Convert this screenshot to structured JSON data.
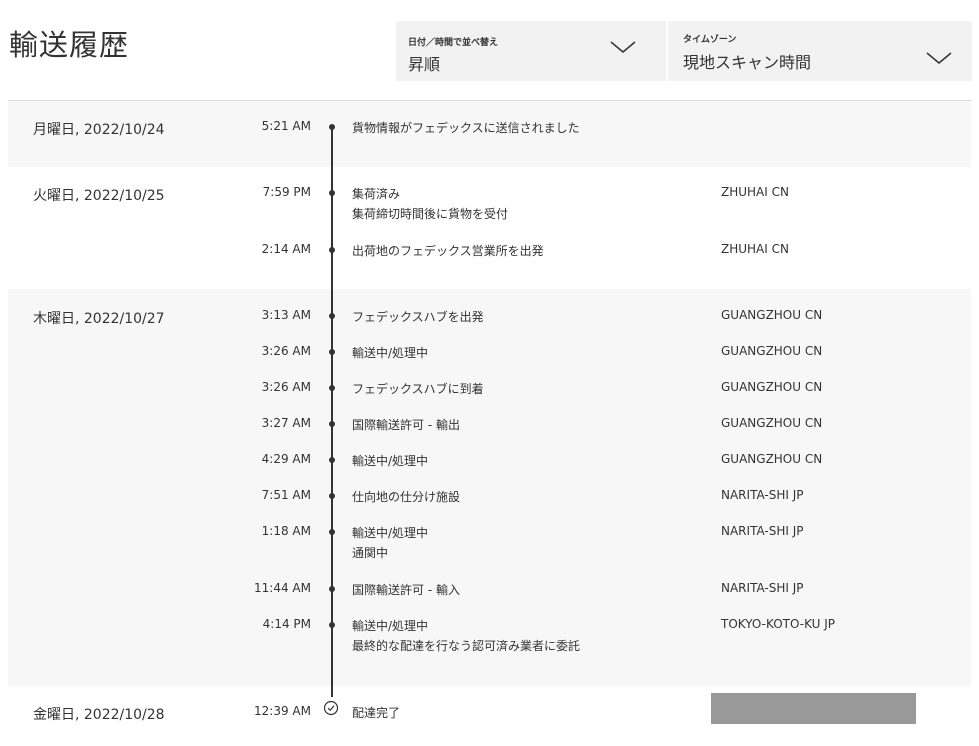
{
  "title": "輸送履歴",
  "sort_dropdown": {
    "label": "日付／時間で並べ替え",
    "value": "昇順",
    "icon": "chevron-down-icon"
  },
  "timezone_dropdown": {
    "label": "タイムゾーン",
    "value": "現地スキャン時間",
    "icon": "chevron-down-icon"
  },
  "groups": [
    {
      "date": "月曜日, 2022/10/24",
      "events": [
        {
          "time": "5:21 AM",
          "event": "貨物情報がフェデックスに送信されました",
          "sub": "",
          "location": ""
        }
      ]
    },
    {
      "date": "火曜日, 2022/10/25",
      "events": [
        {
          "time": "7:59 PM",
          "event": "集荷済み",
          "sub": "集荷締切時間後に貨物を受付",
          "location": "ZHUHAI CN"
        },
        {
          "time": "2:14 AM",
          "event": "出荷地のフェデックス営業所を出発",
          "sub": "",
          "location": "ZHUHAI CN"
        }
      ]
    },
    {
      "date": "木曜日, 2022/10/27",
      "events": [
        {
          "time": "3:13 AM",
          "event": "フェデックスハブを出発",
          "sub": "",
          "location": "GUANGZHOU CN"
        },
        {
          "time": "3:26 AM",
          "event": "輸送中/処理中",
          "sub": "",
          "location": "GUANGZHOU CN"
        },
        {
          "time": "3:26 AM",
          "event": "フェデックスハブに到着",
          "sub": "",
          "location": "GUANGZHOU CN"
        },
        {
          "time": "3:27 AM",
          "event": "国際輸送許可 - 輸出",
          "sub": "",
          "location": "GUANGZHOU CN"
        },
        {
          "time": "4:29 AM",
          "event": "輸送中/処理中",
          "sub": "",
          "location": "GUANGZHOU CN"
        },
        {
          "time": "7:51 AM",
          "event": "仕向地の仕分け施設",
          "sub": "",
          "location": "NARITA-SHI JP"
        },
        {
          "time": "1:18 AM",
          "event": "輸送中/処理中",
          "sub": "通関中",
          "location": "NARITA-SHI JP"
        },
        {
          "time": "11:44 AM",
          "event": "国際輸送許可 - 輸入",
          "sub": "",
          "location": "NARITA-SHI JP"
        },
        {
          "time": "4:14 PM",
          "event": "輸送中/処理中",
          "sub": "最終的な配達を行なう認可済み業者に委託",
          "location": "TOKYO-KOTO-KU JP"
        }
      ]
    },
    {
      "date": "金曜日, 2022/10/28",
      "events": [
        {
          "time": "12:39 AM",
          "event": "配達完了",
          "sub": "",
          "location": "",
          "icon": "check-circle-icon"
        }
      ]
    }
  ]
}
